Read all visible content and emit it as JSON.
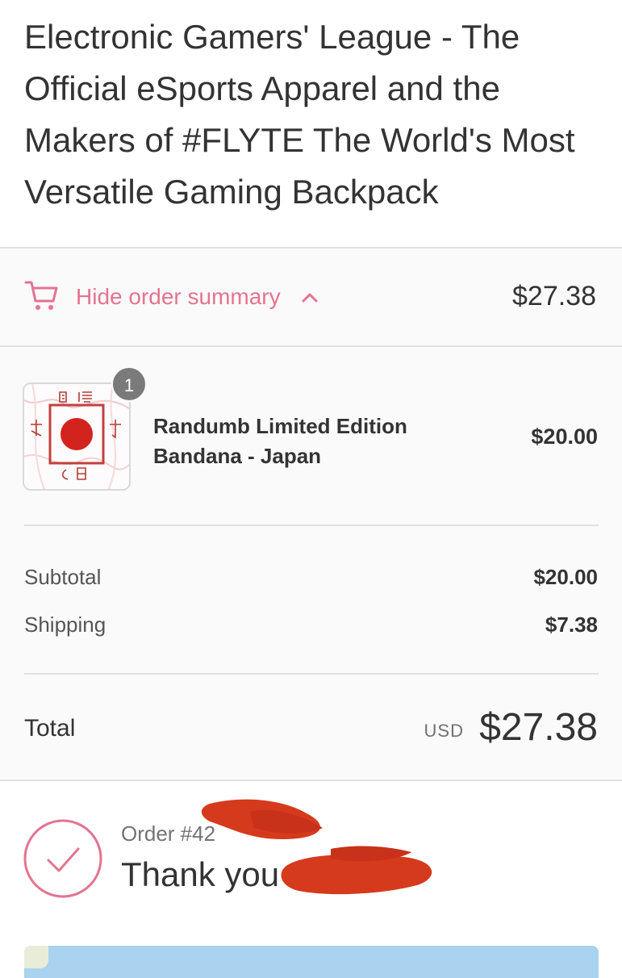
{
  "store": {
    "title": "Electronic Gamers' League - The Official eSports Apparel and the Makers of #FLYTE The World's Most Versatile Gaming Backpack"
  },
  "summary_toggle": {
    "label": "Hide order summary",
    "icon": "cart-icon",
    "chevron": "chevron-up-icon",
    "total": "$27.38",
    "accent_color": "#e5738f"
  },
  "product": {
    "name": "Randumb Limited Edition",
    "variant": "Bandana - Japan",
    "quantity": "1",
    "price": "$20.00"
  },
  "costs": {
    "subtotal_label": "Subtotal",
    "subtotal_value": "$20.00",
    "shipping_label": "Shipping",
    "shipping_value": "$7.38",
    "total_label": "Total",
    "currency": "USD",
    "total_value": "$27.38"
  },
  "confirmation": {
    "order_label": "Order #42",
    "thank_you": "Thank you",
    "icon": "checkmark-icon"
  }
}
